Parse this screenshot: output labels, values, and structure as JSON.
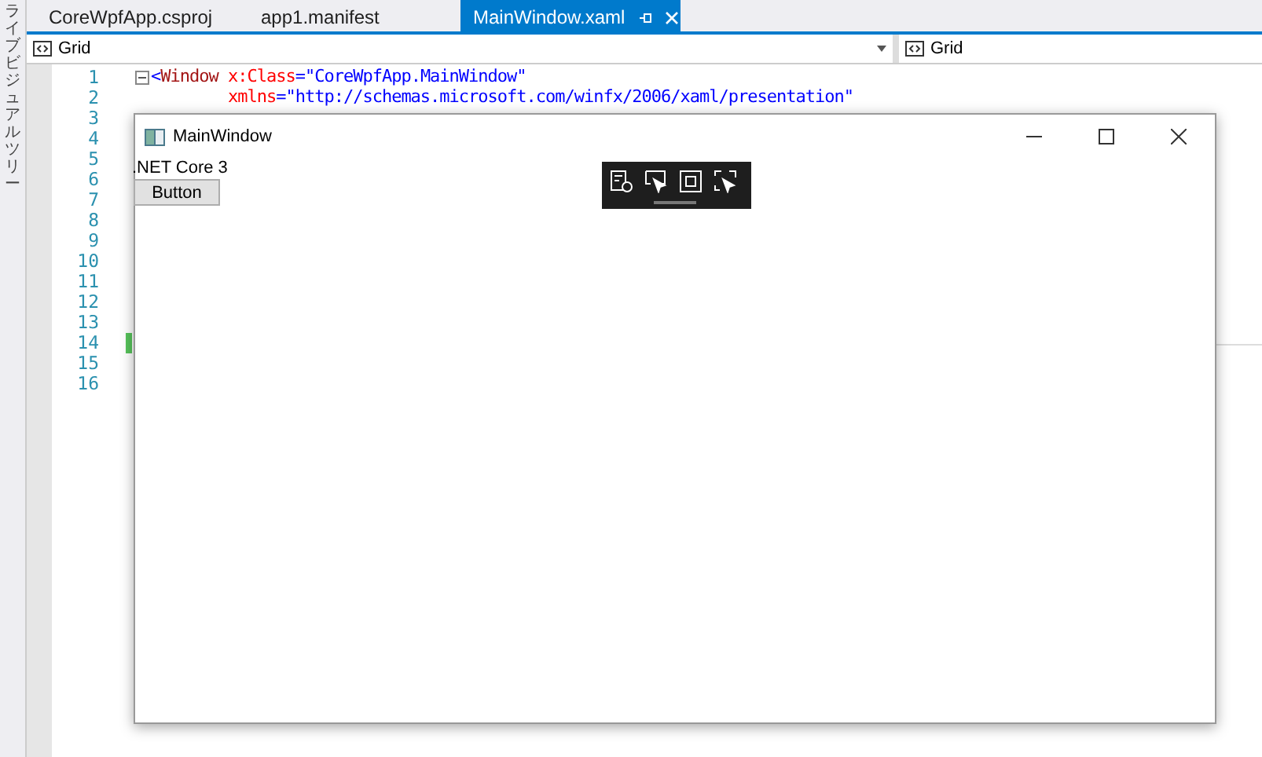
{
  "side_panel": {
    "label": "ライブビジュアルツリー"
  },
  "tabs": [
    {
      "label": "CoreWpfApp.csproj",
      "selected": false
    },
    {
      "label": "app1.manifest",
      "selected": false
    },
    {
      "label": "MainWindow.xaml",
      "selected": true
    }
  ],
  "nav_bar": {
    "left": "Grid",
    "right": "Grid"
  },
  "editor": {
    "lines": [
      {
        "number": "1",
        "modified": false,
        "tokens": [
          {
            "kind": "punct",
            "text": "<"
          },
          {
            "kind": "tag",
            "text": "Window "
          },
          {
            "kind": "attr",
            "text": "x:Class"
          },
          {
            "kind": "punct",
            "text": "="
          },
          {
            "kind": "value",
            "text": "\"CoreWpfApp.MainWindow\""
          }
        ]
      },
      {
        "number": "2",
        "modified": false,
        "tokens": [
          {
            "kind": "attr",
            "text": "        xmlns"
          },
          {
            "kind": "punct",
            "text": "="
          },
          {
            "kind": "value",
            "text": "\"http://schemas.microsoft.com/winfx/2006/xaml/presentation\""
          }
        ]
      },
      {
        "number": "3",
        "modified": false
      },
      {
        "number": "4",
        "modified": false
      },
      {
        "number": "5",
        "modified": false
      },
      {
        "number": "6",
        "modified": false
      },
      {
        "number": "7",
        "modified": false
      },
      {
        "number": "8",
        "modified": false
      },
      {
        "number": "9",
        "modified": false
      },
      {
        "number": "10",
        "modified": false
      },
      {
        "number": "11",
        "modified": false
      },
      {
        "number": "12",
        "modified": false
      },
      {
        "number": "13",
        "modified": false
      },
      {
        "number": "14",
        "modified": true
      },
      {
        "number": "15",
        "modified": false
      },
      {
        "number": "16",
        "modified": false
      }
    ]
  },
  "app_window": {
    "title": "MainWindow",
    "label": ".NET Core 3",
    "button": "Button"
  }
}
